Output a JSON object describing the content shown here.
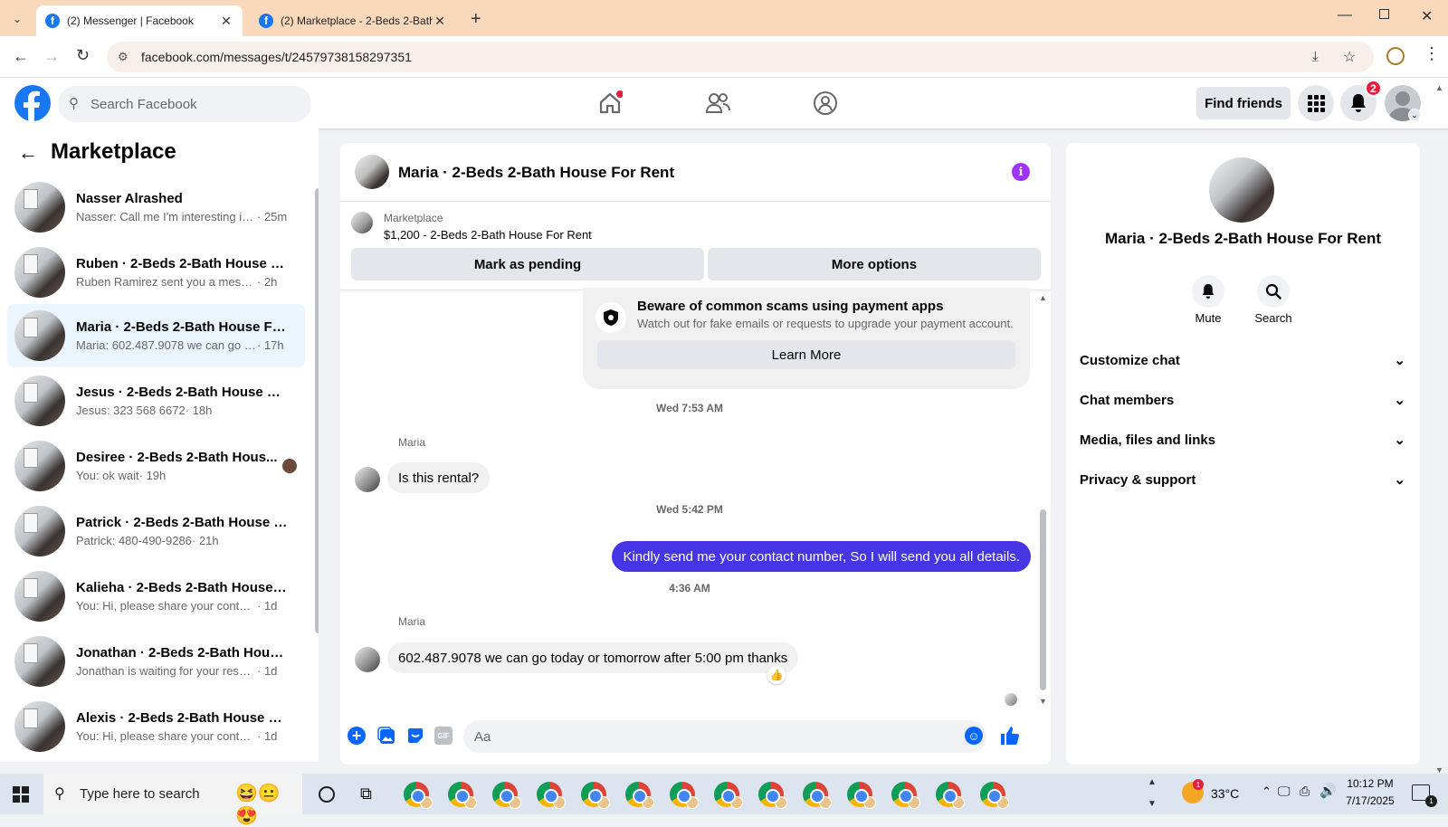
{
  "browser": {
    "tabs": [
      {
        "title": "(2) Messenger | Facebook"
      },
      {
        "title": "(2) Marketplace - 2-Beds 2-Bath"
      }
    ],
    "url": "facebook.com/messages/t/24579738158297351"
  },
  "header": {
    "search_placeholder": "Search Facebook",
    "find_friends": "Find friends",
    "notif_count": "2"
  },
  "sidebar": {
    "title": "Marketplace",
    "conversations": [
      {
        "name": "Nasser Alrashed",
        "preview": "Nasser: Call me I'm interesting in ...",
        "time": "· 25m"
      },
      {
        "name": "Ruben · 2-Beds 2-Bath House Fo...",
        "preview": "Ruben Ramirez sent you a message...",
        "time": "· 2h"
      },
      {
        "name": "Maria · 2-Beds 2-Bath House For...",
        "preview": "Maria: 602.487.9078 we can go to...",
        "time": "· 17h"
      },
      {
        "name": "Jesus · 2-Beds 2-Bath House For...",
        "preview": "Jesus: 323 568 6672",
        "time": "· 18h"
      },
      {
        "name": "Desiree · 2-Beds 2-Bath Hous...",
        "preview": "You: ok wait",
        "time": "· 19h"
      },
      {
        "name": "Patrick · 2-Beds 2-Bath House F...",
        "preview": "Patrick: 480-490-9286",
        "time": "· 21h"
      },
      {
        "name": "Kalieha · 2-Beds 2-Bath House F...",
        "preview": "You: Hi, please share your contact n...",
        "time": "· 1d"
      },
      {
        "name": "Jonathan · 2-Beds 2-Bath House...",
        "preview": "Jonathan is waiting for your respon...",
        "time": "· 1d"
      },
      {
        "name": "Alexis · 2-Beds 2-Bath House Fo...",
        "preview": "You: Hi, please share your contact n...",
        "time": "· 1d"
      }
    ]
  },
  "chat": {
    "title": "Maria · 2-Beds 2-Bath House For Rent",
    "listing_label": "Marketplace",
    "listing_desc": "$1,200 - 2-Beds 2-Bath House For Rent",
    "mark_pending": "Mark as pending",
    "more_options": "More options",
    "scam_title": "Beware of common scams using payment apps",
    "scam_desc": "Watch out for fake emails or requests to upgrade your payment account.",
    "learn_more": "Learn More",
    "messages": [
      {
        "timestamp": "Wed 7:53 AM"
      },
      {
        "sender": "Maria",
        "text": "Is this rental?"
      },
      {
        "timestamp": "Wed 5:42 PM"
      },
      {
        "text": "Kindly send me your contact number, So I will send you all details."
      },
      {
        "timestamp": "4:36 AM"
      },
      {
        "sender": "Maria",
        "text": "602.487.9078 we can go today or tomorrow after 5:00 pm thanks",
        "reaction": "👍"
      }
    ],
    "composer_placeholder": "Aa"
  },
  "info": {
    "name": "Maria · 2-Beds 2-Bath House For Rent",
    "mute": "Mute",
    "search": "Search",
    "sections": [
      "Customize chat",
      "Chat members",
      "Media, files and links",
      "Privacy & support"
    ]
  },
  "taskbar": {
    "search_placeholder": "Type here to search",
    "temperature": "33°C",
    "time": "10:12 PM",
    "date": "7/17/2025",
    "notif_count": "1"
  },
  "colors": {
    "brand": "#1877f2",
    "my_bubble": "#4535e5",
    "accent_purple": "#a033ff"
  }
}
